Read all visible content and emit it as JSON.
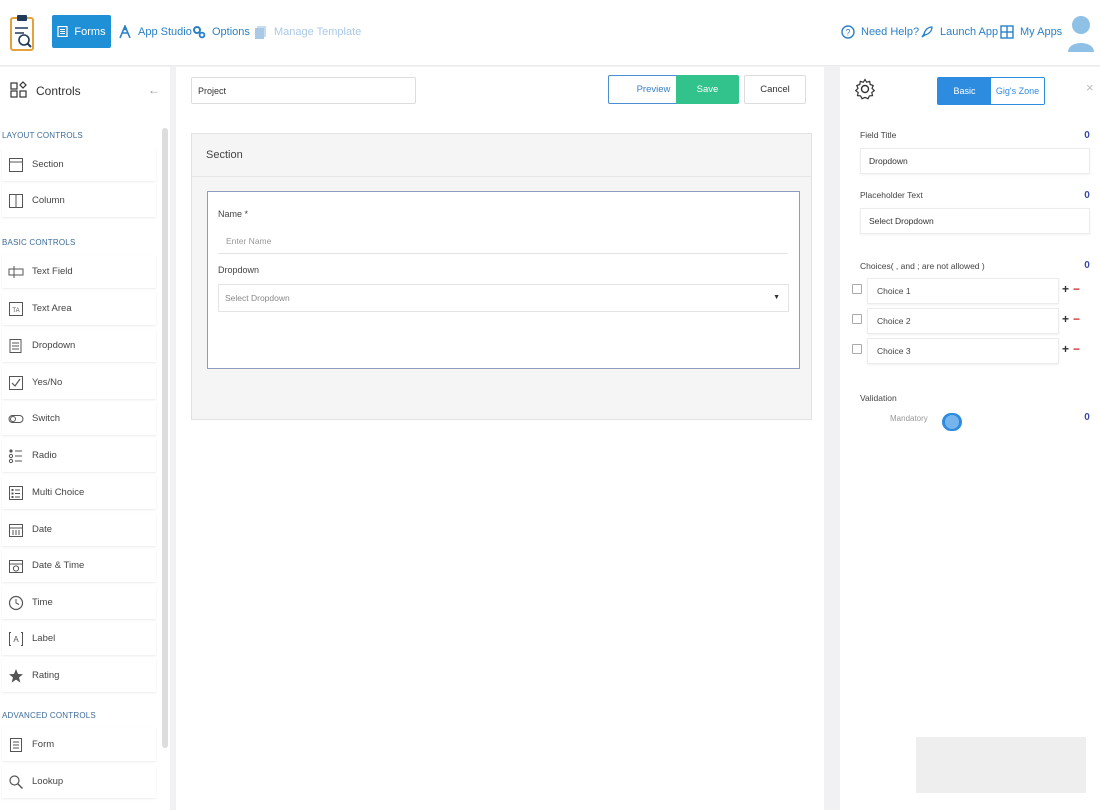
{
  "topbar": {
    "nav": [
      {
        "label": "Forms",
        "icon": "form-icon",
        "active": true
      },
      {
        "label": "App Studio",
        "icon": "app-studio-icon"
      },
      {
        "label": "Options",
        "icon": "options-icon"
      },
      {
        "label": "Manage Template",
        "icon": "template-icon",
        "disabled": true
      }
    ],
    "right": [
      {
        "label": "Need Help?",
        "icon": "help-icon"
      },
      {
        "label": "Launch App",
        "icon": "rocket-icon"
      },
      {
        "label": "My Apps",
        "icon": "grid-icon"
      }
    ]
  },
  "sidebar": {
    "title": "Controls",
    "sections": [
      {
        "heading": "LAYOUT CONTROLS",
        "items": [
          {
            "label": "Section",
            "icon": "section-icon"
          },
          {
            "label": "Column",
            "icon": "column-icon"
          }
        ]
      },
      {
        "heading": "BASIC CONTROLS",
        "items": [
          {
            "label": "Text Field",
            "icon": "text-field-icon"
          },
          {
            "label": "Text Area",
            "icon": "text-area-icon"
          },
          {
            "label": "Dropdown",
            "icon": "dropdown-icon"
          },
          {
            "label": "Yes/No",
            "icon": "checkbox-icon"
          },
          {
            "label": "Switch",
            "icon": "switch-icon"
          },
          {
            "label": "Radio",
            "icon": "radio-icon"
          },
          {
            "label": "Multi Choice",
            "icon": "multi-choice-icon"
          },
          {
            "label": "Date",
            "icon": "calendar-icon"
          },
          {
            "label": "Date & Time",
            "icon": "calendar-clock-icon"
          },
          {
            "label": "Time",
            "icon": "clock-icon"
          },
          {
            "label": "Label",
            "icon": "label-icon"
          },
          {
            "label": "Rating",
            "icon": "star-icon"
          }
        ]
      },
      {
        "heading": "ADVANCED CONTROLS",
        "items": [
          {
            "label": "Form",
            "icon": "form-doc-icon"
          },
          {
            "label": "Lookup",
            "icon": "search-icon"
          }
        ]
      }
    ]
  },
  "canvas": {
    "form_name": "Project",
    "buttons": {
      "preview": "Preview",
      "save": "Save",
      "cancel": "Cancel"
    },
    "section_title": "Section",
    "fields": {
      "name_label": "Name *",
      "name_placeholder": "Enter Name",
      "dropdown_label": "Dropdown",
      "dropdown_placeholder": "Select Dropdown"
    }
  },
  "panel": {
    "tabs": {
      "basic": "Basic",
      "zone": "Gig's Zone"
    },
    "field_title_label": "Field Title",
    "field_title_value": "Dropdown",
    "placeholder_label": "Placeholder Text",
    "placeholder_value": "Select Dropdown",
    "choices_label": "Choices( , and ; are not allowed )",
    "choices": [
      "Choice 1",
      "Choice 2",
      "Choice 3"
    ],
    "validation_label": "Validation",
    "mandatory_label": "Mandatory",
    "mandatory_on": true,
    "info_glyph": "0"
  },
  "colors": {
    "accent": "#1f8fd6",
    "save": "#31c38b",
    "remove": "#d23232",
    "info": "#3b4aa8"
  }
}
